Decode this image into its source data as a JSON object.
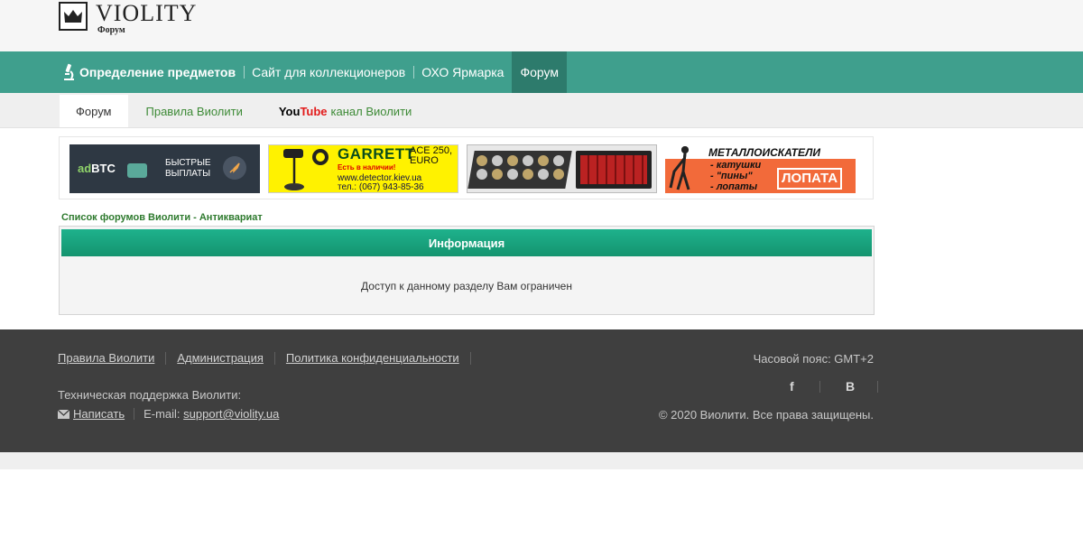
{
  "header": {
    "logo_title": "VIOLITY",
    "logo_subtitle": "Форум"
  },
  "main_nav": {
    "items": [
      {
        "label": "Определение предметов",
        "icon": "microscope-icon"
      },
      {
        "label": "Сайт для коллекционеров"
      },
      {
        "label": "ОХО Ярмарка"
      },
      {
        "label": "Форум",
        "active": true
      }
    ]
  },
  "sub_nav": {
    "tabs": [
      {
        "label": "Форум",
        "active": true
      },
      {
        "label": "Правила Виолити"
      },
      {
        "label_you": "You",
        "label_tube": "Tube",
        "label_rest": "канал Виолити"
      }
    ]
  },
  "banners": {
    "adbtc": {
      "brand_ad": "ad",
      "brand_btc": "BTC",
      "text_line1": "БЫСТРЫЕ",
      "text_line2": "ВЫПЛАТЫ"
    },
    "garrett": {
      "brand": "GARRETT",
      "model": "ACE 250,",
      "model2": "EURO",
      "stock": "Есть в наличии!",
      "site": "www.detector.kiev.ua",
      "phone": "тел.: (067) 943-85-36"
    },
    "metal": {
      "title": "МЕТАЛЛОИСКАТЕЛИ",
      "line1": "- катушки",
      "line2": "- \"пины\"",
      "line3": "- лопаты",
      "brand": "ЛОПАТА"
    }
  },
  "breadcrumb": "Список форумов Виолити - Антиквариат",
  "info": {
    "title": "Информация",
    "message": "Доступ к данному разделу Вам ограничен"
  },
  "footer": {
    "links": [
      "Правила Виолити",
      "Администрация",
      "Политика конфиденциальности"
    ],
    "support_label": "Техническая поддержка Виолити:",
    "write_label": "Написать",
    "email_label": "E-mail:",
    "email": "support@violity.ua",
    "timezone": "Часовой пояс: GMT+2",
    "social_fb": "f",
    "social_vk": "В",
    "copyright": "© 2020 Виолити. Все права защищены."
  },
  "colors": {
    "nav_bg": "#3f9f8d",
    "nav_active": "#2d7b6c",
    "info_header": "#1aa682",
    "footer_bg": "#3f3f3f"
  }
}
